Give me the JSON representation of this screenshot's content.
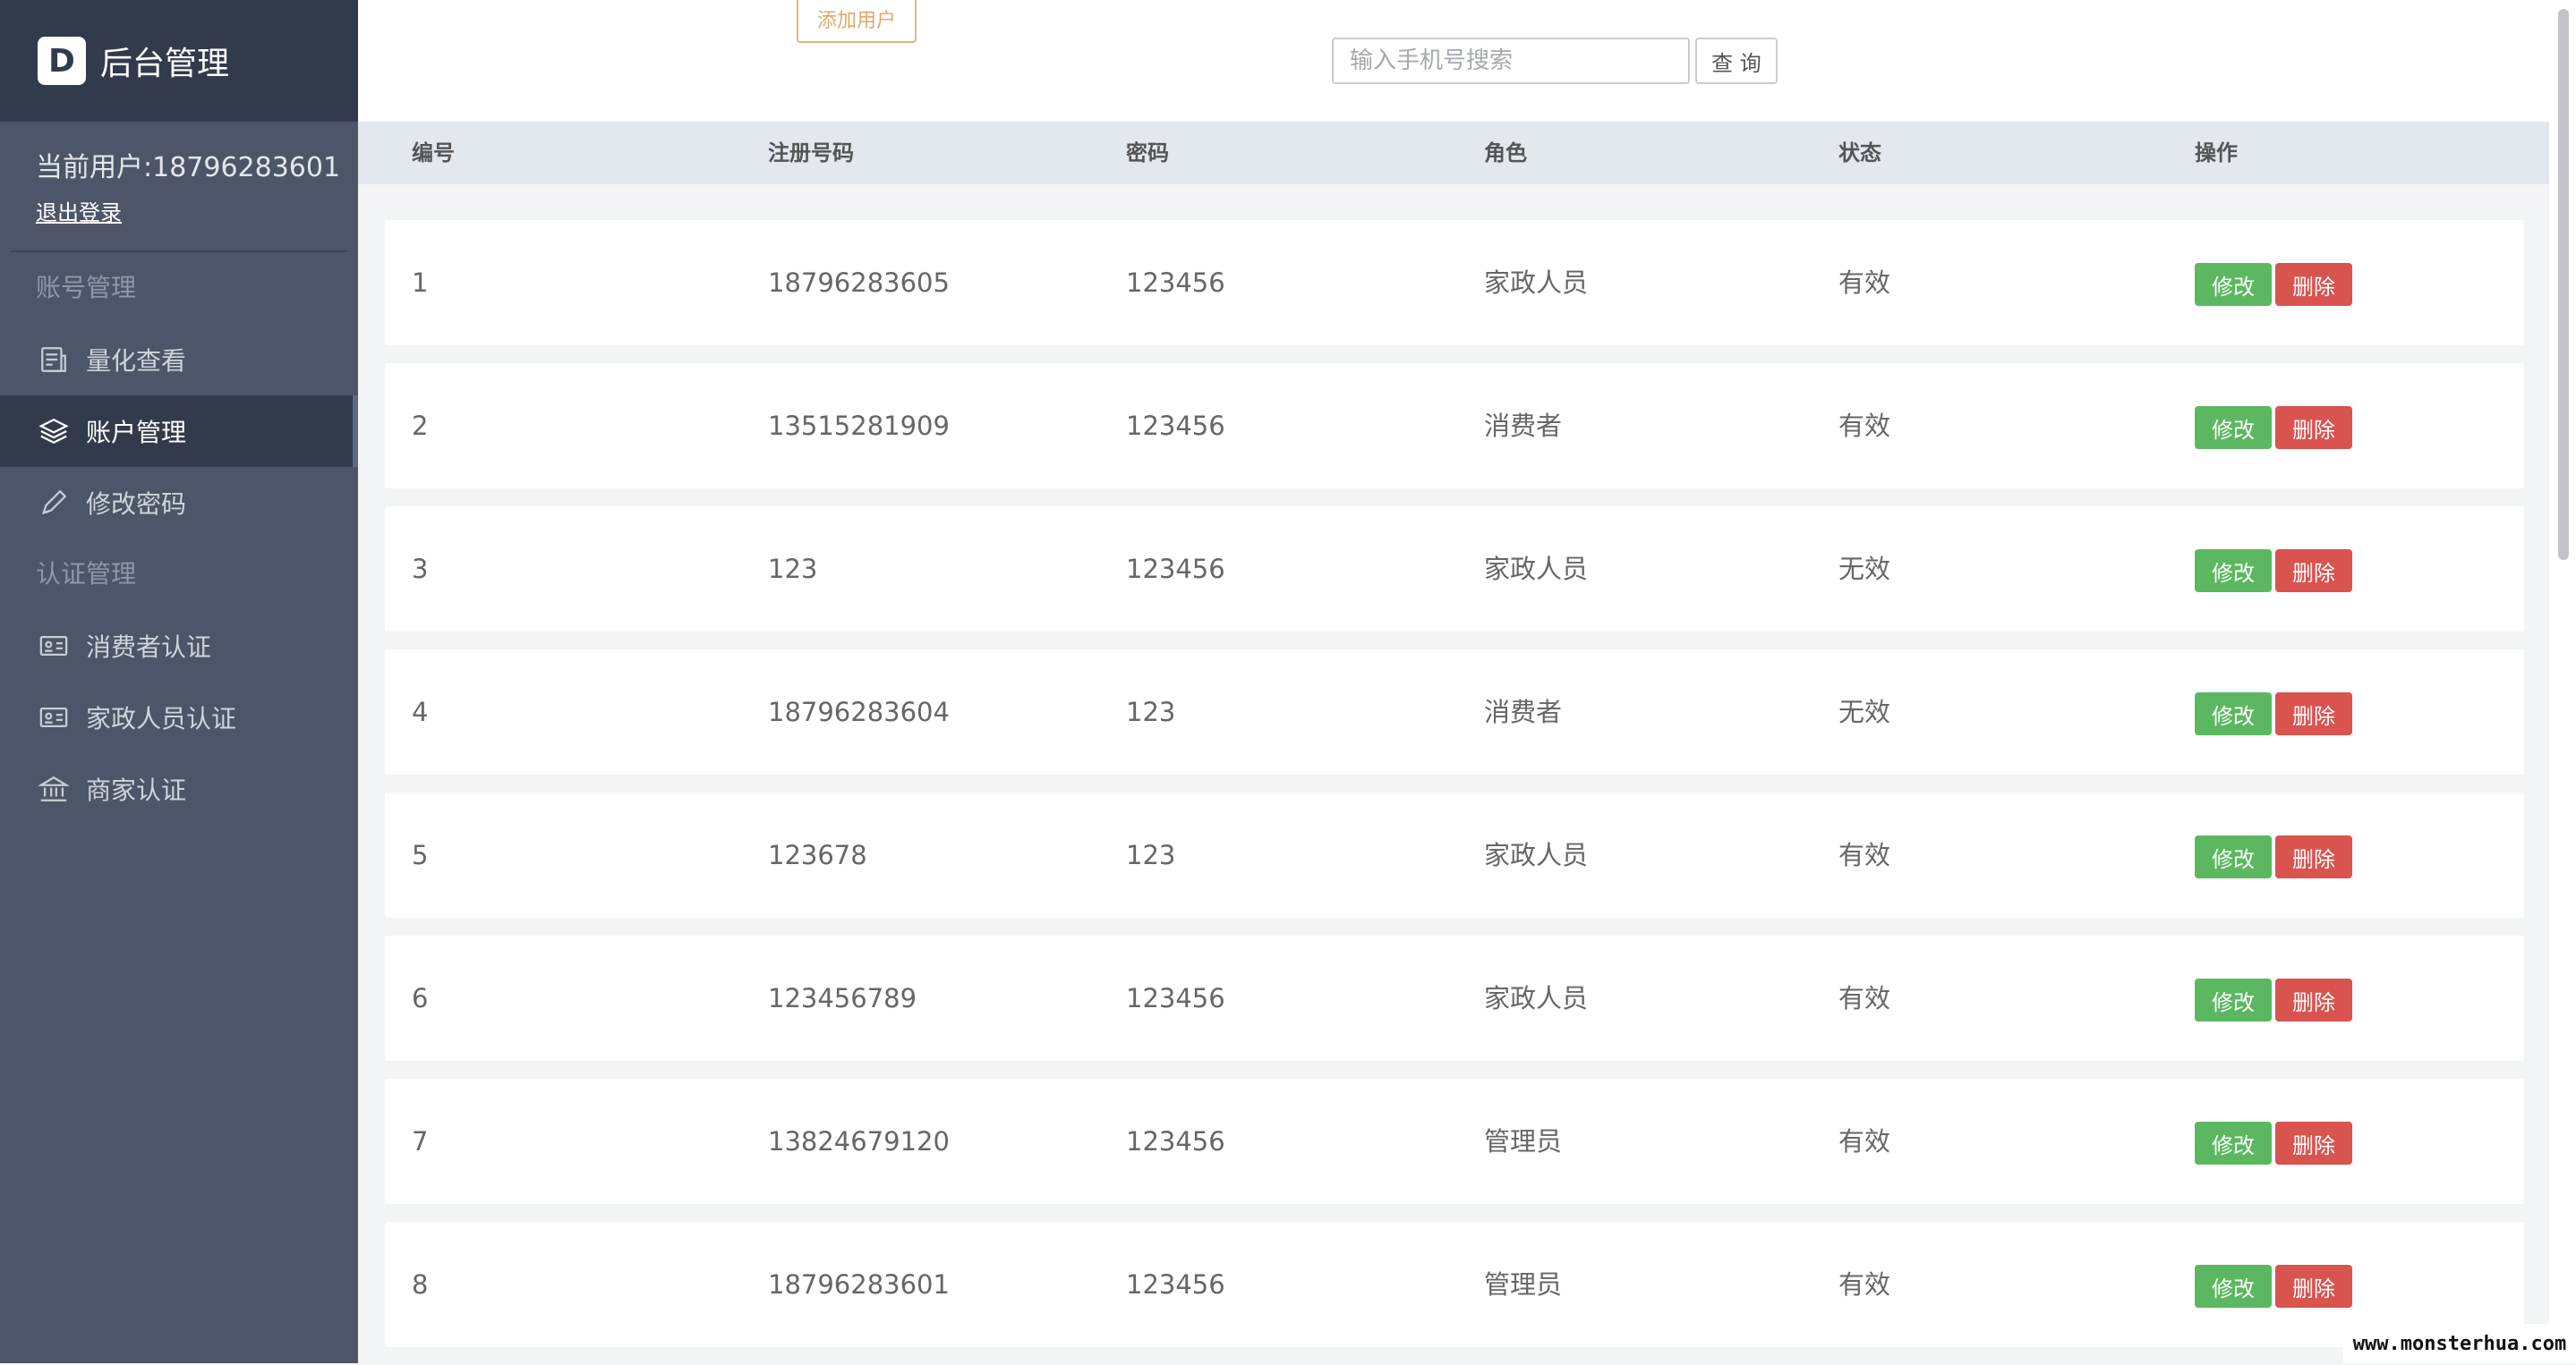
{
  "sidebar": {
    "brand_logo": "D",
    "brand_title": "后台管理",
    "current_user": "当前用户:18796283601",
    "logout": "退出登录",
    "groups": [
      {
        "title": "账号管理",
        "items": [
          {
            "label": "量化查看",
            "icon": "report-icon",
            "active": false
          },
          {
            "label": "账户管理",
            "icon": "layers-icon",
            "active": true
          },
          {
            "label": "修改密码",
            "icon": "pencil-icon",
            "active": false
          }
        ]
      },
      {
        "title": "认证管理",
        "items": [
          {
            "label": "消费者认证",
            "icon": "id-card-icon",
            "active": false
          },
          {
            "label": "家政人员认证",
            "icon": "id-card-icon",
            "active": false
          },
          {
            "label": "商家认证",
            "icon": "bank-icon",
            "active": false
          }
        ]
      }
    ]
  },
  "toolbar": {
    "add_user": "添加用户",
    "search_placeholder": "输入手机号搜索",
    "search_value": "",
    "search_button": "查 询"
  },
  "table": {
    "columns": [
      "编号",
      "注册号码",
      "密码",
      "角色",
      "状态",
      "操作"
    ],
    "rows": [
      {
        "id": "1",
        "phone": "18796283605",
        "password": "123456",
        "role": "家政人员",
        "status": "有效"
      },
      {
        "id": "2",
        "phone": "13515281909",
        "password": "123456",
        "role": "消费者",
        "status": "有效"
      },
      {
        "id": "3",
        "phone": "123",
        "password": "123456",
        "role": "家政人员",
        "status": "无效"
      },
      {
        "id": "4",
        "phone": "18796283604",
        "password": "123",
        "role": "消费者",
        "status": "无效"
      },
      {
        "id": "5",
        "phone": "123678",
        "password": "123",
        "role": "家政人员",
        "status": "有效"
      },
      {
        "id": "6",
        "phone": "123456789",
        "password": "123456",
        "role": "家政人员",
        "status": "有效"
      },
      {
        "id": "7",
        "phone": "13824679120",
        "password": "123456",
        "role": "管理员",
        "status": "有效"
      },
      {
        "id": "8",
        "phone": "18796283601",
        "password": "123456",
        "role": "管理员",
        "status": "有效"
      }
    ],
    "edit_label": "修改",
    "delete_label": "删除"
  },
  "watermark": "www.monsterhua.com",
  "colors": {
    "sidebar_bg": "#4d5668",
    "sidebar_dark": "#323b4c",
    "edit_button": "#5cb860",
    "delete_button": "#d9534f",
    "add_user_border": "#e5b57a"
  }
}
